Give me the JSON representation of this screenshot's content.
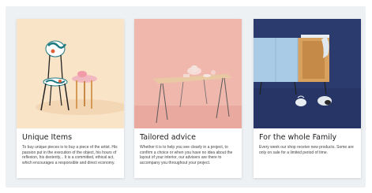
{
  "cards": [
    {
      "title": "Unique Items",
      "text": "To buy unique pieces is to buy a piece of the artist. His passion put in the execution of the object, his hours of reflexion, his dexterity... It is a committed, ethical act, which encourages a responsible and direct economy.",
      "image_icon": "chair-and-table-photo"
    },
    {
      "title": "Tailored advice",
      "text": "Whether it is to help you see clearly in a project, to confirm a choice or when you have no idea about the layout of your interior, our advisers are there to accompany you throughout your project.",
      "image_icon": "desk-and-lamp-photo"
    },
    {
      "title": "For the whole Family",
      "text": "Every week our shop receive new products. Some are only on sale for a limited period of time.",
      "image_icon": "sideboard-and-shoes-photo"
    }
  ],
  "colors": {
    "card1_bg": "#f9e4c8",
    "card2_bg": "#f0b7ad",
    "card3_bg": "#2b3b6e",
    "page_bg": "#eef1f4"
  }
}
